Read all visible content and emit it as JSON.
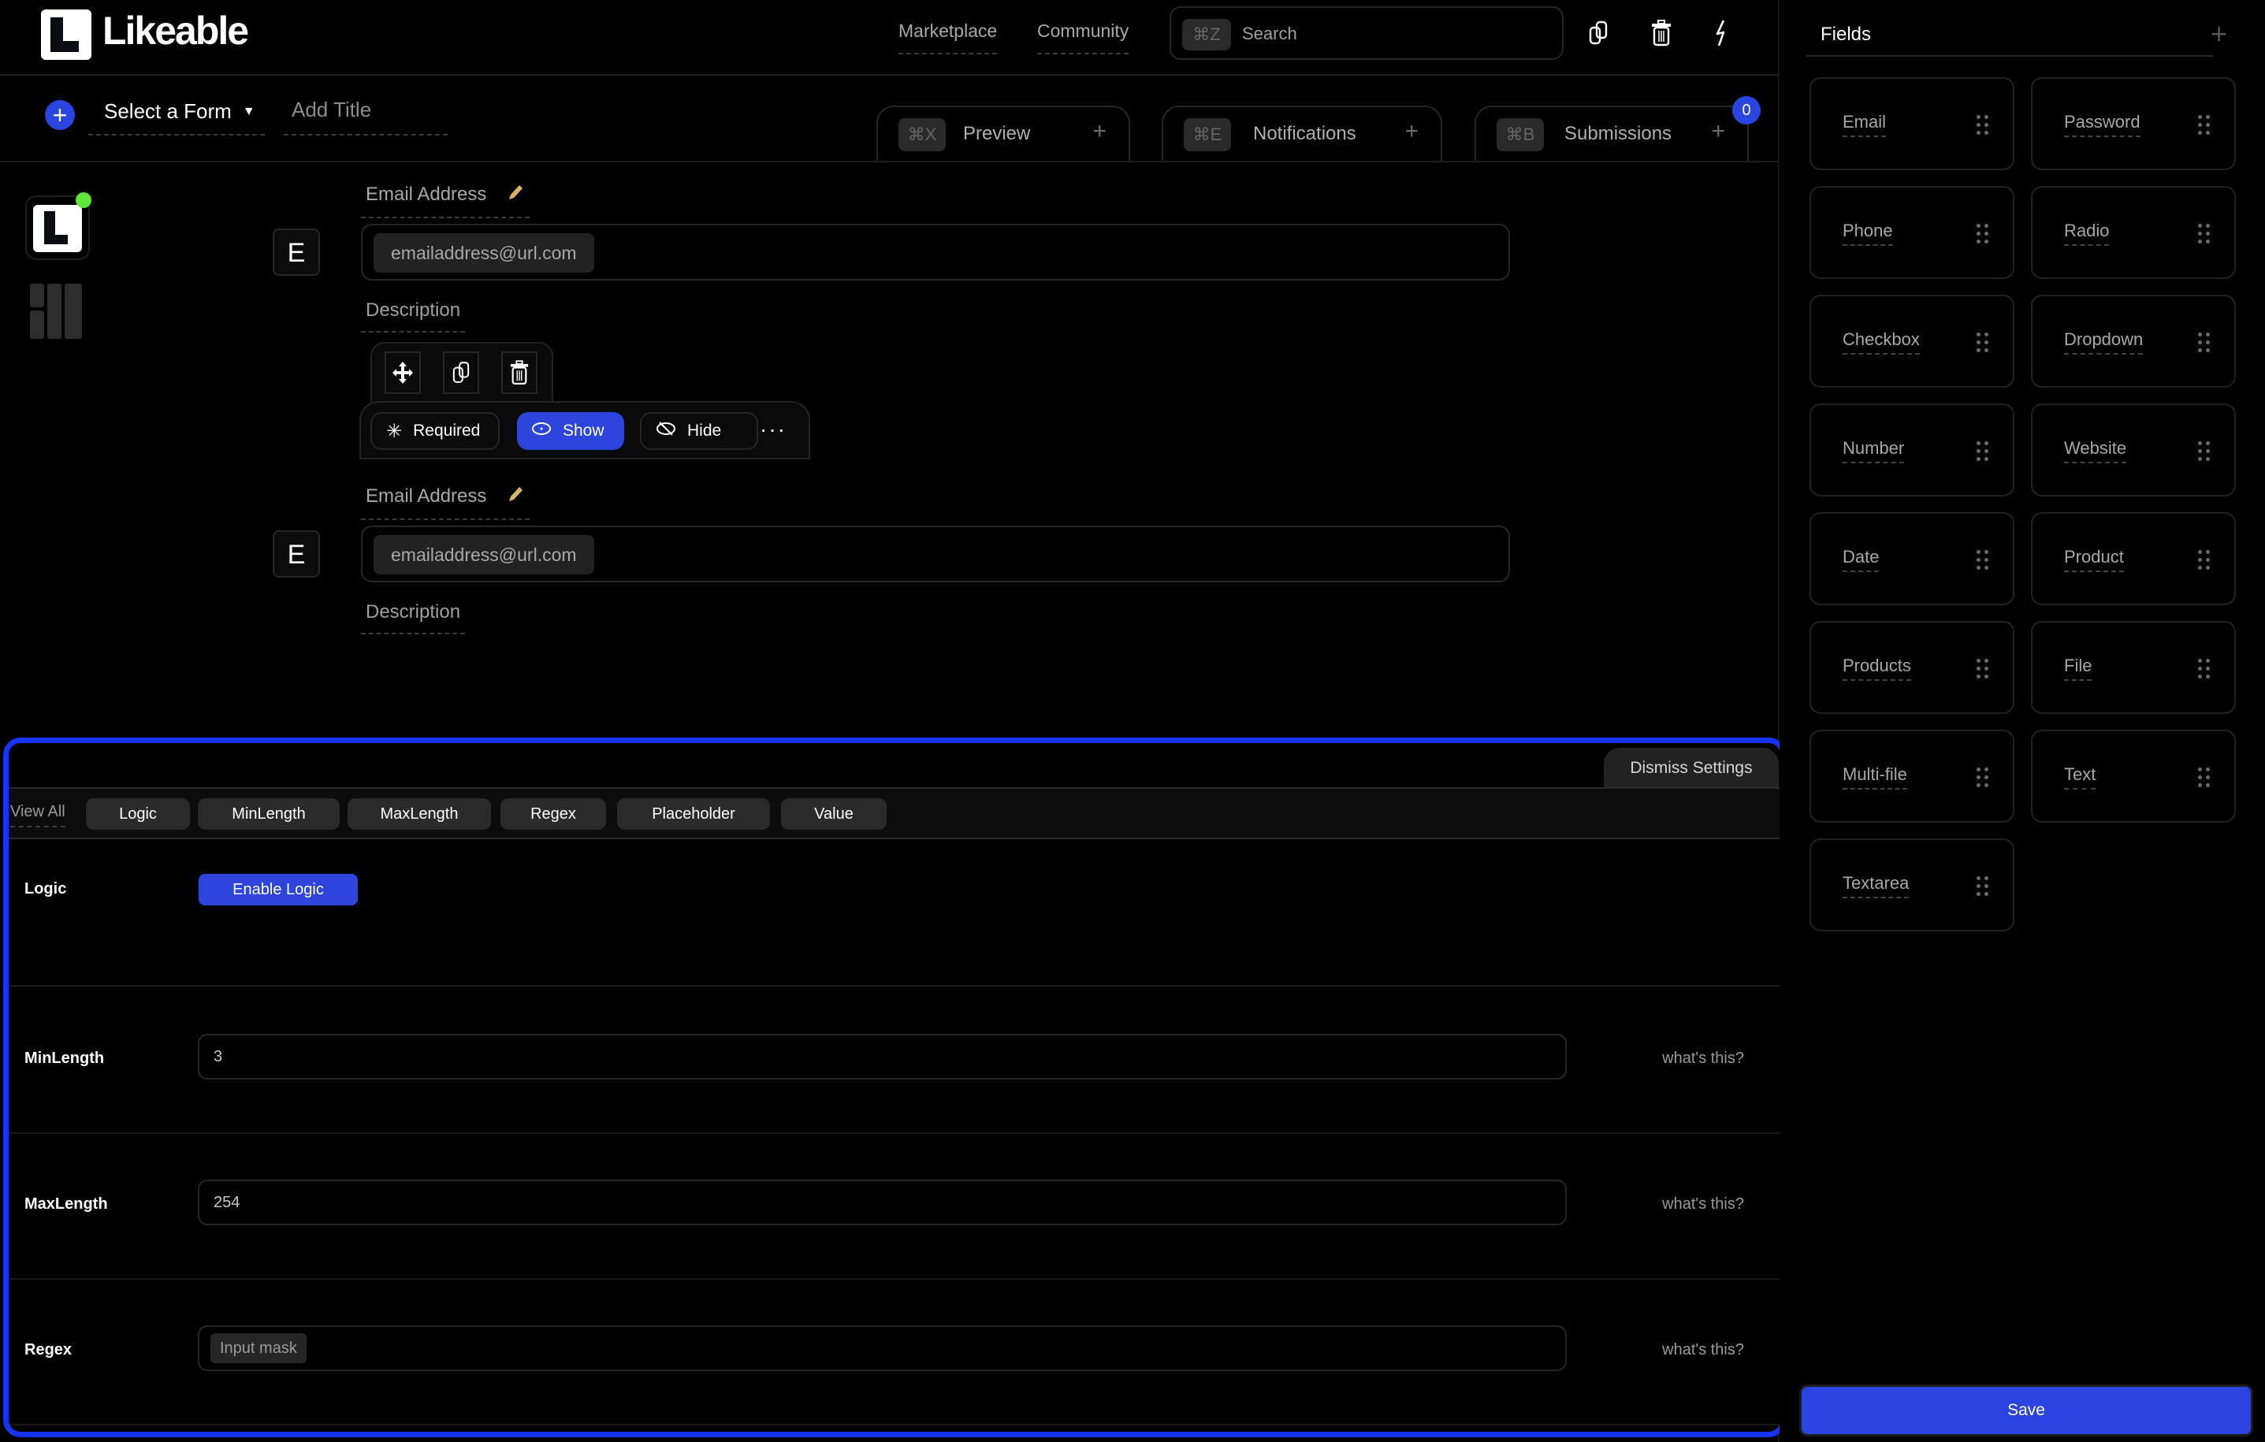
{
  "app": {
    "brand": "Likeable"
  },
  "header": {
    "nav": [
      {
        "label": "Marketplace"
      },
      {
        "label": "Community"
      }
    ],
    "search": {
      "shortcut": "⌘Z",
      "placeholder": "Search"
    },
    "actions": [
      {
        "icon": "copy-icon"
      },
      {
        "icon": "trash-icon"
      },
      {
        "icon": "lightning-icon"
      }
    ]
  },
  "subheader": {
    "add_button_label": "+",
    "form_select": "Select a Form",
    "title_placeholder": "Add Title",
    "tabs": [
      {
        "shortcut": "⌘X",
        "label": "Preview",
        "add": "+"
      },
      {
        "shortcut": "⌘E",
        "label": "Notifications",
        "add": "+"
      },
      {
        "shortcut": "⌘B",
        "label": "Submissions",
        "add": "+"
      }
    ],
    "submissions_badge": "0"
  },
  "rail": {
    "status_color": "#5fe63a"
  },
  "canvas": {
    "fields": [
      {
        "badge": "E",
        "label": "Email Address",
        "value": "emailaddress@url.com",
        "description": "Description"
      },
      {
        "badge": "E",
        "label": "Email Address",
        "value": "emailaddress@url.com",
        "description": "Description"
      }
    ],
    "toolbar": {
      "actions": [
        {
          "icon": "move-icon"
        },
        {
          "icon": "copy-icon"
        },
        {
          "icon": "trash-icon"
        }
      ],
      "required_label": "Required",
      "show_label": "Show",
      "hide_label": "Hide",
      "more_label": "···"
    }
  },
  "settings": {
    "dismiss_label": "Dismiss Settings",
    "view_all_label": "View All",
    "filters": [
      "Logic",
      "MinLength",
      "MaxLength",
      "Regex",
      "Placeholder",
      "Value"
    ],
    "rows": {
      "logic": {
        "label": "Logic",
        "button": "Enable Logic"
      },
      "minlength": {
        "label": "MinLength",
        "value": "3",
        "help": "what's this?"
      },
      "maxlength": {
        "label": "MaxLength",
        "value": "254",
        "help": "what's this?"
      },
      "regex": {
        "label": "Regex",
        "chip": "Input mask",
        "help": "what's this?"
      }
    }
  },
  "sidebar": {
    "title": "Fields",
    "add_label": "+",
    "fields": [
      "Email",
      "Password",
      "Phone",
      "Radio",
      "Checkbox",
      "Dropdown",
      "Number",
      "Website",
      "Date",
      "Product",
      "Products",
      "File",
      "Multi-file",
      "Text",
      "Textarea"
    ],
    "save_label": "Save"
  },
  "colors": {
    "accent": "#2d45dd",
    "highlight_border": "#1534f7",
    "pencil": "#d8b565",
    "background": "#000000"
  }
}
